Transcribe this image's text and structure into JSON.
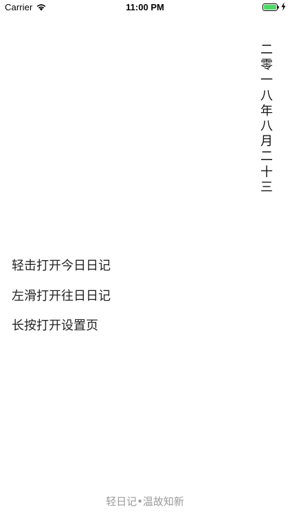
{
  "status_bar": {
    "carrier": "Carrier",
    "time": "11:00 PM",
    "icons": [
      "wifi-icon",
      "battery-icon",
      "charging-bolt-icon"
    ],
    "battery_color": "#4cd964"
  },
  "date": {
    "characters": [
      "二",
      "零",
      "一",
      "八",
      "年",
      "八",
      "月",
      "二",
      "十",
      "三"
    ]
  },
  "instructions": [
    {
      "label": "轻击打开今日日记"
    },
    {
      "label": "左滑打开往日日记"
    },
    {
      "label": "长按打开设置页"
    }
  ],
  "footer": {
    "text": "轻日记•温故知新"
  }
}
